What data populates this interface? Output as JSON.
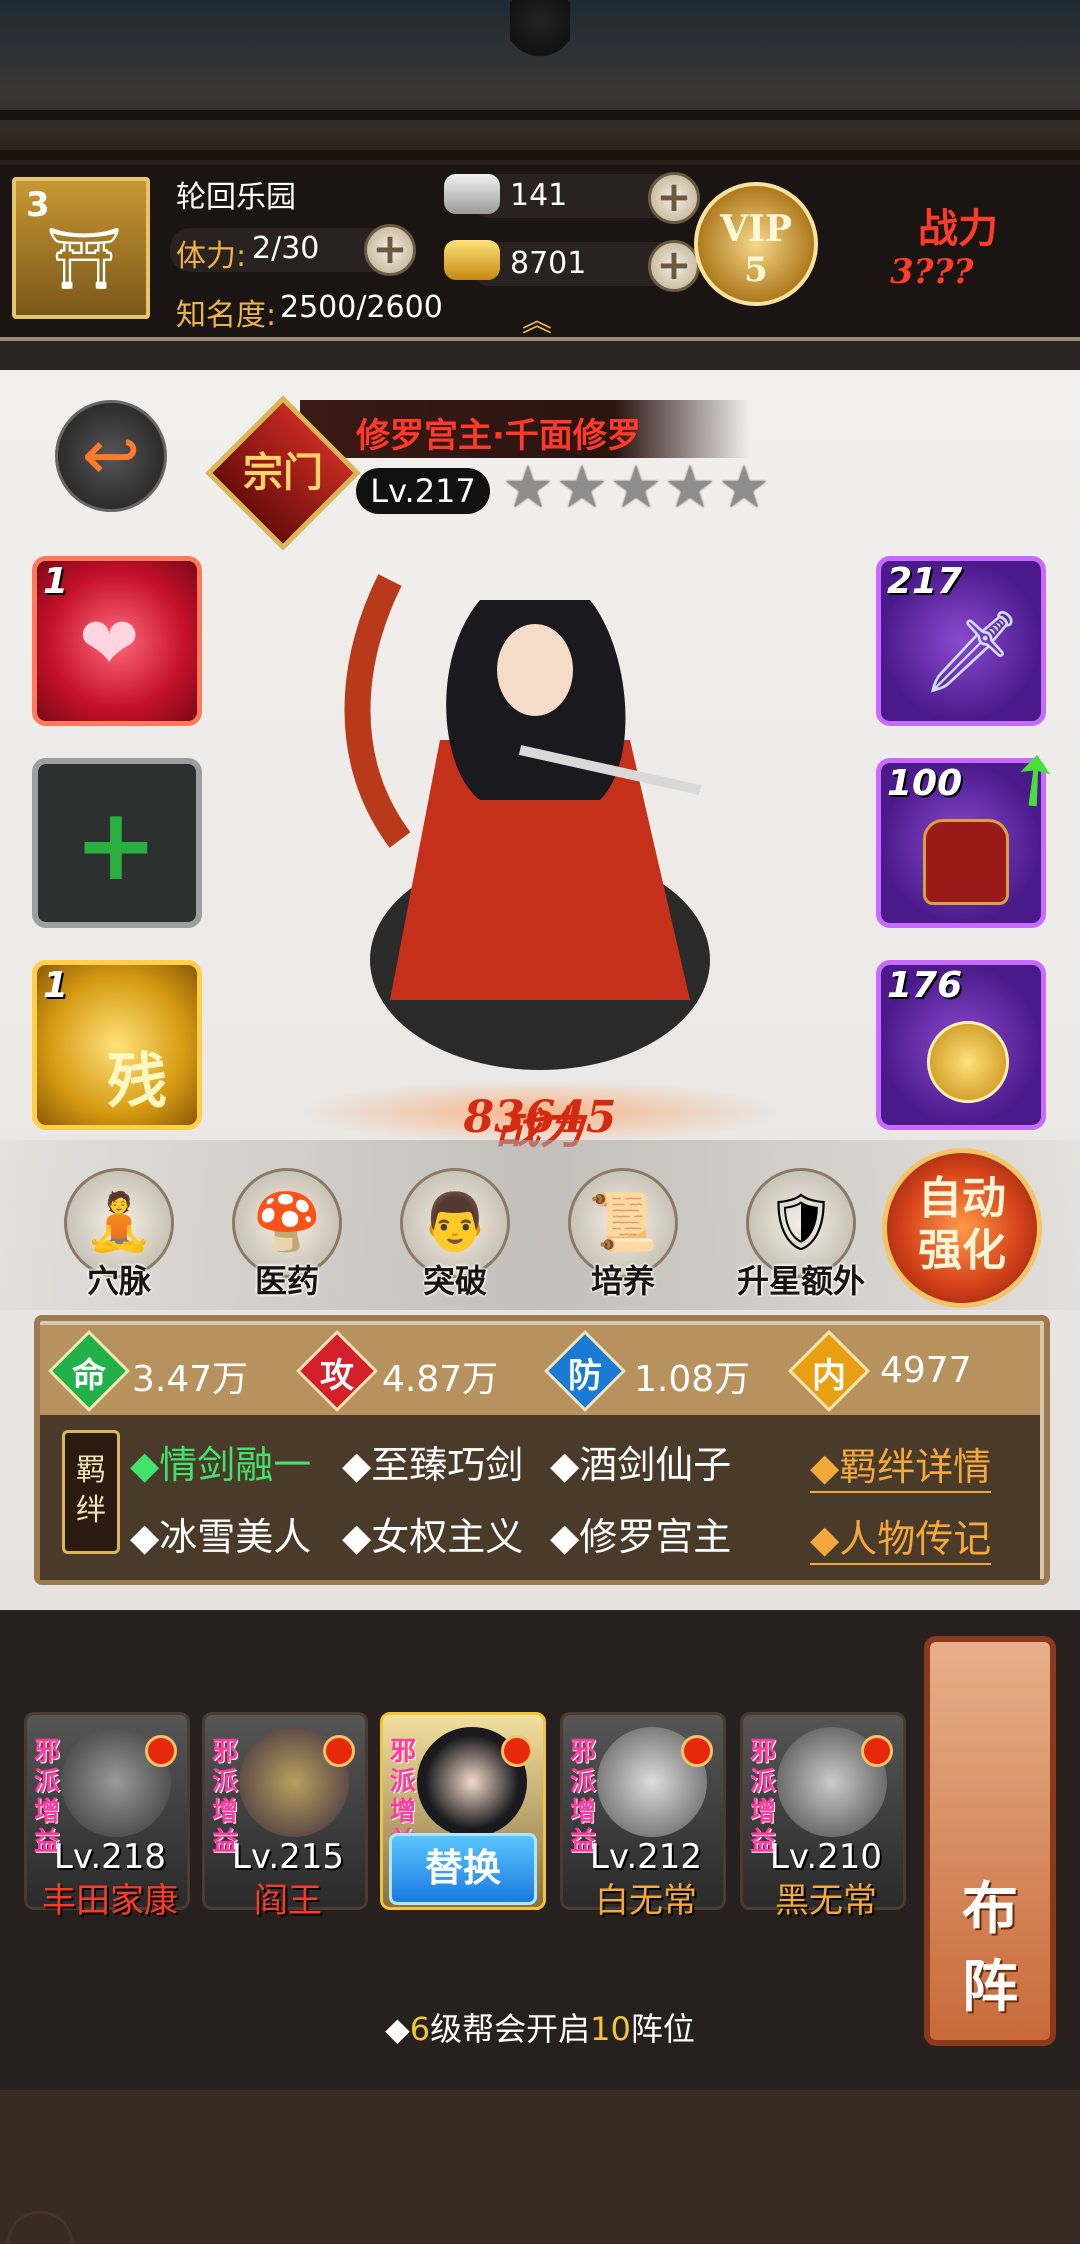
{
  "header": {
    "house_level": "3",
    "location_name": "轮回乐园",
    "stamina_label": "体力:",
    "stamina_value": "2/30",
    "fame_label": "知名度:",
    "fame_value": "2500/2600",
    "silver_value": "141",
    "gold_value": "8701",
    "vip_label": "VIP",
    "vip_level": "5",
    "power_label": "战力",
    "power_value": "3???"
  },
  "hero": {
    "name": "修罗宫主·千面修罗",
    "rank_badge": "宗门",
    "level": "Lv.217",
    "stars": 5,
    "power_label": "战力",
    "power_value": "83645",
    "left_slots": [
      {
        "count": "1",
        "kind": "heart-swirl"
      },
      {
        "count": "",
        "kind": "empty-plus"
      },
      {
        "count": "1",
        "kind": "gold-remnant",
        "glyph": "残"
      }
    ],
    "right_slots": [
      {
        "count": "217",
        "kind": "sword"
      },
      {
        "count": "100",
        "kind": "armor"
      },
      {
        "count": "176",
        "kind": "jade"
      }
    ]
  },
  "menu": {
    "items": [
      "穴脉",
      "医药",
      "突破",
      "培养",
      "升星额外"
    ],
    "auto_label_line1": "自动",
    "auto_label_line2": "强化"
  },
  "stats": {
    "items": [
      {
        "label": "命",
        "value": "3.47万",
        "color": "#22b04a"
      },
      {
        "label": "攻",
        "value": "4.87万",
        "color": "#d4202a"
      },
      {
        "label": "防",
        "value": "1.08万",
        "color": "#1a7ad4"
      },
      {
        "label": "内",
        "value": "4977",
        "color": "#e8a012"
      }
    ]
  },
  "bonds": {
    "label": "羁绊",
    "items": [
      "◆情剑融一",
      "◆至臻巧剑",
      "◆酒剑仙子",
      "◆冰雪美人",
      "◆女权主义",
      "◆修罗宫主"
    ],
    "detail_link": "◆羁绊详情",
    "bio_link": "◆人物传记"
  },
  "team": {
    "tag": "邪派增益",
    "members": [
      {
        "level": "Lv.218",
        "name": "丰田家康",
        "name_color": "#ff3a2a"
      },
      {
        "level": "Lv.215",
        "name": "阎王",
        "name_color": "#ff3a2a"
      },
      {
        "level": "",
        "name": "",
        "swap_label": "替换"
      },
      {
        "level": "Lv.212",
        "name": "白无常",
        "name_color": "#f2a83a"
      },
      {
        "level": "Lv.210",
        "name": "黑无常",
        "name_color": "#f2a83a"
      }
    ],
    "formation_label_1": "布",
    "formation_label_2": "阵",
    "unlock_prefix": "◆",
    "unlock_level": "6",
    "unlock_mid": "级帮会开启",
    "unlock_count": "10",
    "unlock_suffix": "阵位"
  }
}
